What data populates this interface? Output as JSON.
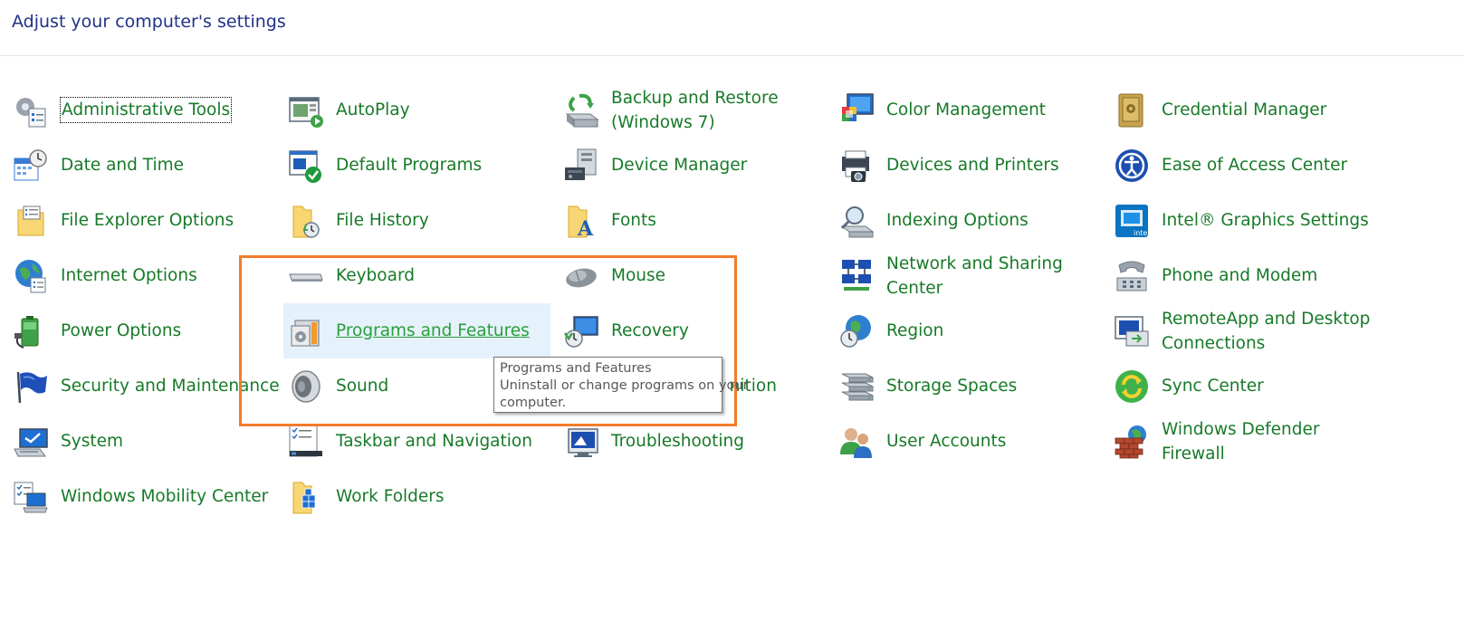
{
  "header": {
    "title": "Adjust your computer's settings"
  },
  "items": {
    "administrative_tools": "Administrative Tools",
    "autoplay": "AutoPlay",
    "backup_restore_1": "Backup and Restore",
    "backup_restore_2": "(Windows 7)",
    "color_management": "Color Management",
    "credential_manager": "Credential Manager",
    "date_time": "Date and Time",
    "default_programs": "Default Programs",
    "device_manager": "Device Manager",
    "devices_printers": "Devices and Printers",
    "ease_of_access": "Ease of Access Center",
    "file_explorer_options": "File Explorer Options",
    "file_history": "File History",
    "fonts": "Fonts",
    "indexing_options": "Indexing Options",
    "intel_graphics": "Intel® Graphics Settings",
    "internet_options": "Internet Options",
    "keyboard": "Keyboard",
    "mouse": "Mouse",
    "network_sharing_1": "Network and Sharing",
    "network_sharing_2": "Center",
    "phone_modem": "Phone and Modem",
    "power_options": "Power Options",
    "programs_features": "Programs and Features",
    "recovery": "Recovery",
    "region": "Region",
    "remoteapp_1": "RemoteApp and Desktop",
    "remoteapp_2": "Connections",
    "security_maintenance": "Security and Maintenance",
    "sound": "Sound",
    "speech_recognition_partial": "nition",
    "storage_spaces": "Storage Spaces",
    "sync_center": "Sync Center",
    "system": "System",
    "taskbar_navigation": "Taskbar and Navigation",
    "troubleshooting": "Troubleshooting",
    "user_accounts": "User Accounts",
    "firewall_1": "Windows Defender",
    "firewall_2": "Firewall",
    "mobility_center": "Windows Mobility Center",
    "work_folders": "Work Folders"
  },
  "tooltip": {
    "title": "Programs and Features",
    "line1": "Uninstall or change programs on your",
    "line2": "computer."
  },
  "colors": {
    "link": "#177a28",
    "header": "#1e3287",
    "highlight": "#f37b2b",
    "selection": "#e5f1fb"
  }
}
